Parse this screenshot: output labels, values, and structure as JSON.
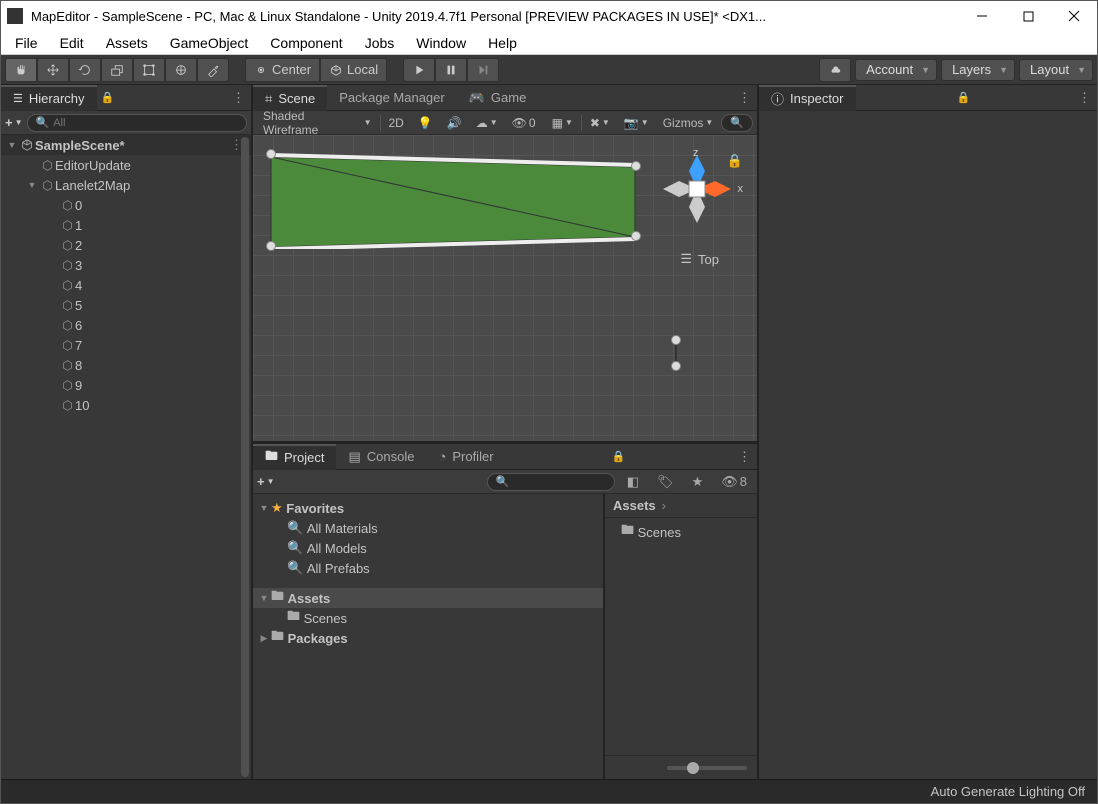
{
  "window": {
    "title": "MapEditor - SampleScene - PC, Mac & Linux Standalone - Unity 2019.4.7f1 Personal [PREVIEW PACKAGES IN USE]* <DX1..."
  },
  "menu": [
    "File",
    "Edit",
    "Assets",
    "GameObject",
    "Component",
    "Jobs",
    "Window",
    "Help"
  ],
  "toolbar": {
    "center": "Center",
    "local": "Local",
    "account": "Account",
    "layers": "Layers",
    "layout": "Layout"
  },
  "hierarchy": {
    "tab": "Hierarchy",
    "search": "All",
    "scene": "SampleScene*",
    "items": [
      "EditorUpdate",
      "Lanelet2Map",
      "0",
      "1",
      "2",
      "3",
      "4",
      "5",
      "6",
      "7",
      "8",
      "9",
      "10"
    ]
  },
  "scene": {
    "tabs": {
      "scene": "Scene",
      "pm": "Package Manager",
      "game": "Game"
    },
    "shading": "Shaded Wireframe",
    "twoD": "2D",
    "zero": "0",
    "gizmo_z": "z",
    "gizmo_x": "x",
    "top": "Top"
  },
  "inspector": {
    "tab": "Inspector"
  },
  "project": {
    "tabs": {
      "project": "Project",
      "console": "Console",
      "profiler": "Profiler"
    },
    "eight": "8",
    "favorites": "Favorites",
    "fav_items": [
      "All Materials",
      "All Models",
      "All Prefabs"
    ],
    "assets": "Assets",
    "scenes": "Scenes",
    "packages": "Packages",
    "breadcrumb": "Assets",
    "folder": "Scenes"
  },
  "status": "Auto Generate Lighting Off"
}
